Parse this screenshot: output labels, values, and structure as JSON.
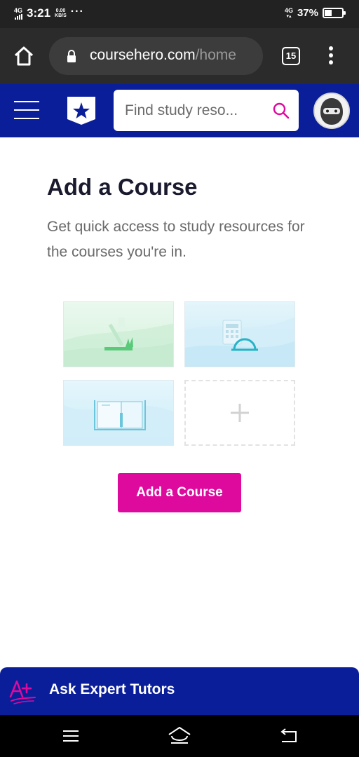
{
  "status_bar": {
    "network_type": "4G",
    "time": "3:21",
    "data_rate_value": "0.00",
    "data_rate_unit": "KB/S",
    "more_dots": "···",
    "network_type_right": "4G",
    "battery_percent": "37%",
    "battery_level": 0.37
  },
  "browser": {
    "url_domain": "coursehero.com",
    "url_path": "/home",
    "tab_count": "15"
  },
  "header": {
    "search_placeholder": "Find study reso..."
  },
  "main": {
    "title": "Add a Course",
    "subtitle": "Get quick access to study resources for the courses you're in.",
    "add_tile_symbol": "+",
    "cta_label": "Add a Course"
  },
  "banner": {
    "label": "Ask Expert Tutors",
    "icon": "a-plus-icon"
  },
  "colors": {
    "brand_blue": "#0a1e9a",
    "cta_magenta": "#de0a9e"
  }
}
